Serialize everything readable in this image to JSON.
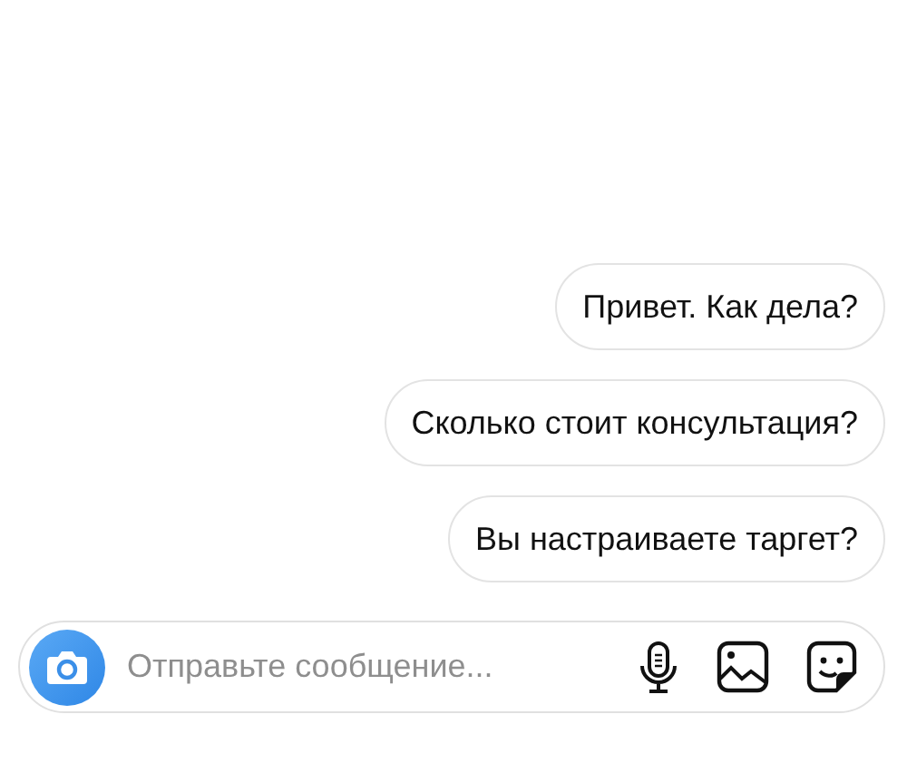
{
  "messages": [
    {
      "text": "Привет. Как дела?"
    },
    {
      "text": "Сколько стоит консультация?"
    },
    {
      "text": "Вы настраиваете таргет?"
    }
  ],
  "composer": {
    "placeholder": "Отправьте сообщение..."
  }
}
